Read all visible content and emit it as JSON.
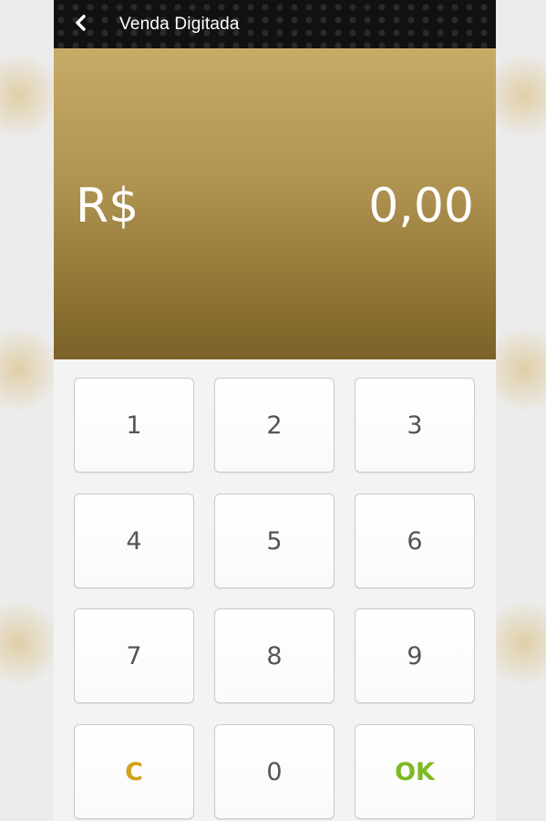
{
  "header": {
    "title": "Venda Digitada",
    "back_icon": "chevron-left-icon"
  },
  "amount": {
    "currency": "R$",
    "value": "0,00"
  },
  "keypad": {
    "keys": [
      "1",
      "2",
      "3",
      "4",
      "5",
      "6",
      "7",
      "8",
      "9",
      "C",
      "0",
      "OK"
    ]
  },
  "colors": {
    "gold_top": "#c7aa66",
    "gold_bottom": "#7a6228",
    "clear_key": "#d1a21a",
    "ok_key": "#7dba24",
    "topbar": "#111111"
  }
}
